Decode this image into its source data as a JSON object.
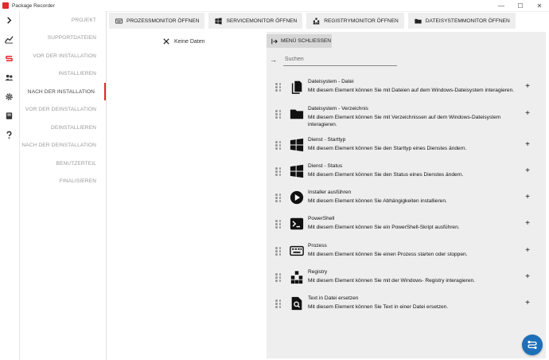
{
  "window": {
    "title": "Package Recorder",
    "controls": [
      "—",
      "☐",
      "✕"
    ]
  },
  "rail": {
    "icons": [
      "chevron-right-icon",
      "chart-icon",
      "package-icon",
      "users-icon",
      "gear-icon",
      "book-icon",
      "help-icon"
    ],
    "accent": "#e02a2a"
  },
  "steps": [
    {
      "label": "PROJEKT"
    },
    {
      "label": "SUPPORTDATEIEN"
    },
    {
      "label": "VOR DER INSTALLATION"
    },
    {
      "label": "INSTALLIEREN"
    },
    {
      "label": "NACH DER INSTALLATION",
      "active": true
    },
    {
      "label": "VOR DER DEINSTALLATION"
    },
    {
      "label": "DEINSTALLIEREN"
    },
    {
      "label": "NACH DER DEINSTALLATION"
    },
    {
      "label": "BENUTZERTEIL"
    },
    {
      "label": "FINALISIEREN"
    }
  ],
  "toolbar": {
    "buttons": [
      {
        "label": "PROZESSMONITOR ÖFFNEN",
        "icon": "keyboard-icon"
      },
      {
        "label": "SERVICEMONITOR ÖFFNEN",
        "icon": "windows-icon"
      },
      {
        "label": "REGISTRYMONITOR ÖFFNEN",
        "icon": "registry-icon"
      },
      {
        "label": "DATEISYSTEMMONITOR ÖFFNEN",
        "icon": "folder-icon"
      }
    ]
  },
  "canvas": {
    "empty_text": "Keine Daten"
  },
  "menu": {
    "close_label": "MENÜ SCHLIESSEN",
    "search_placeholder": "Suchen",
    "items": [
      {
        "title": "Dateisystem - Datei",
        "desc": "Mit diesem Element können Sie mit Dateien auf dem Windows-Dateisystem interagieren.",
        "icon": "file-icon"
      },
      {
        "title": "Dateisystem - Verzeichnis",
        "desc": "Mit diesem Element können Sie mit Verzeichnissen auf dem Windows-Dateisystem interagieren.",
        "icon": "folder-icon"
      },
      {
        "title": "Dienst - Starttyp",
        "desc": "Mit diesem Element können Sie den Starttyp eines Dienstes ändern.",
        "icon": "windows-icon"
      },
      {
        "title": "Dienst - Status",
        "desc": "Mit diesem Element können Sie den Status eines Dienstes ändern.",
        "icon": "windows-icon"
      },
      {
        "title": "Installer ausführen",
        "desc": "Mit diesem Element können Sie Abhängigkeiten installieren.",
        "icon": "play-icon"
      },
      {
        "title": "PowerShell",
        "desc": "Mit diesem Element können Sie ein PowerShell-Skript ausführen.",
        "icon": "terminal-icon"
      },
      {
        "title": "Prozess",
        "desc": "Mit diesem Element können Sie einen Prozess starten oder stoppen.",
        "icon": "keyboard-icon"
      },
      {
        "title": "Registry",
        "desc": "Mit diesem Element können Sie mit der Windows- Registry interagieren.",
        "icon": "registry-icon"
      },
      {
        "title": "Text in Datei ersetzen",
        "desc": "Mit diesem Element können Sie Text in einer Datei ersetzen.",
        "icon": "file-search-icon"
      }
    ],
    "add_symbol": "+"
  },
  "fab": {
    "icon": "workflow-icon",
    "color": "#1d6fb8"
  }
}
